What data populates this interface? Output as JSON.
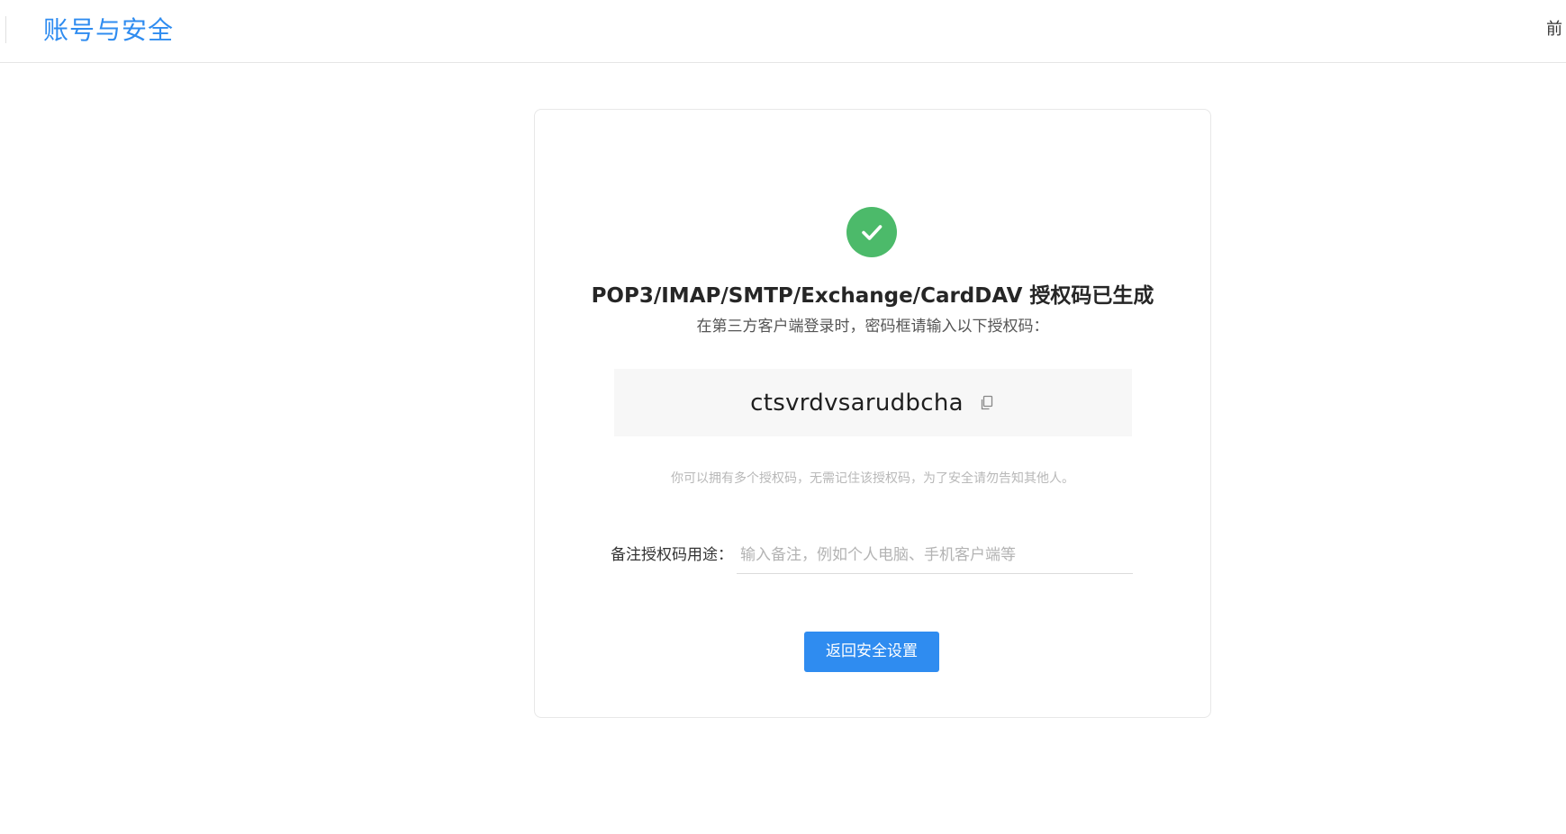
{
  "header": {
    "title": "账号与安全",
    "right_text": "前"
  },
  "card": {
    "status_icon": "check-circle-icon",
    "status_color": "#4cba6a",
    "title": "POP3/IMAP/SMTP/Exchange/CardDAV 授权码已生成",
    "subtitle": "在第三方客户端登录时，密码框请输入以下授权码：",
    "auth_code": "ctsvrdvsarudbcha",
    "copy_icon": "copy-icon",
    "hint": "你可以拥有多个授权码，无需记住该授权码，为了安全请勿告知其他人。",
    "remark": {
      "label": "备注授权码用途：",
      "value": "",
      "placeholder": "输入备注，例如个人电脑、手机客户端等"
    },
    "back_button_label": "返回安全设置"
  },
  "colors": {
    "accent": "#2f8cf0",
    "success": "#4cba6a"
  }
}
